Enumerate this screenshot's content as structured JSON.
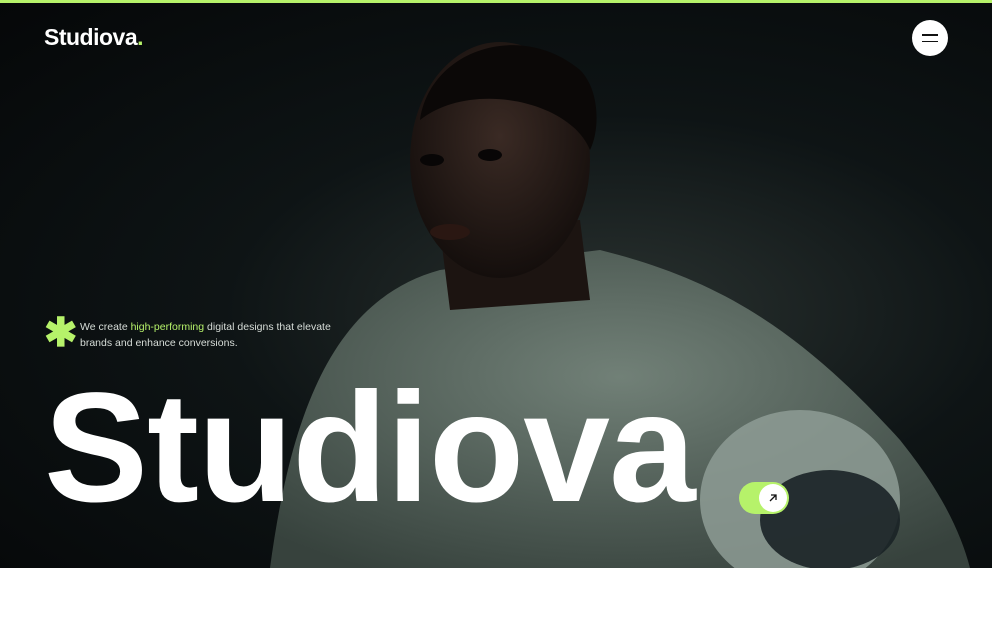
{
  "header": {
    "logo_text": "Studiova",
    "logo_dot": ".",
    "menu_icon": "hamburger-icon"
  },
  "hero": {
    "tagline_pre": "We create ",
    "tagline_highlight": "high-performing",
    "tagline_post": " digital designs that elevate brands and enhance conversions.",
    "big_title": "Studiova",
    "cta_icon": "arrow-up-right-icon",
    "decor_icon": "asterisk-icon"
  },
  "colors": {
    "accent": "#b6f26a",
    "background": "#0e1415",
    "text": "#ffffff"
  }
}
